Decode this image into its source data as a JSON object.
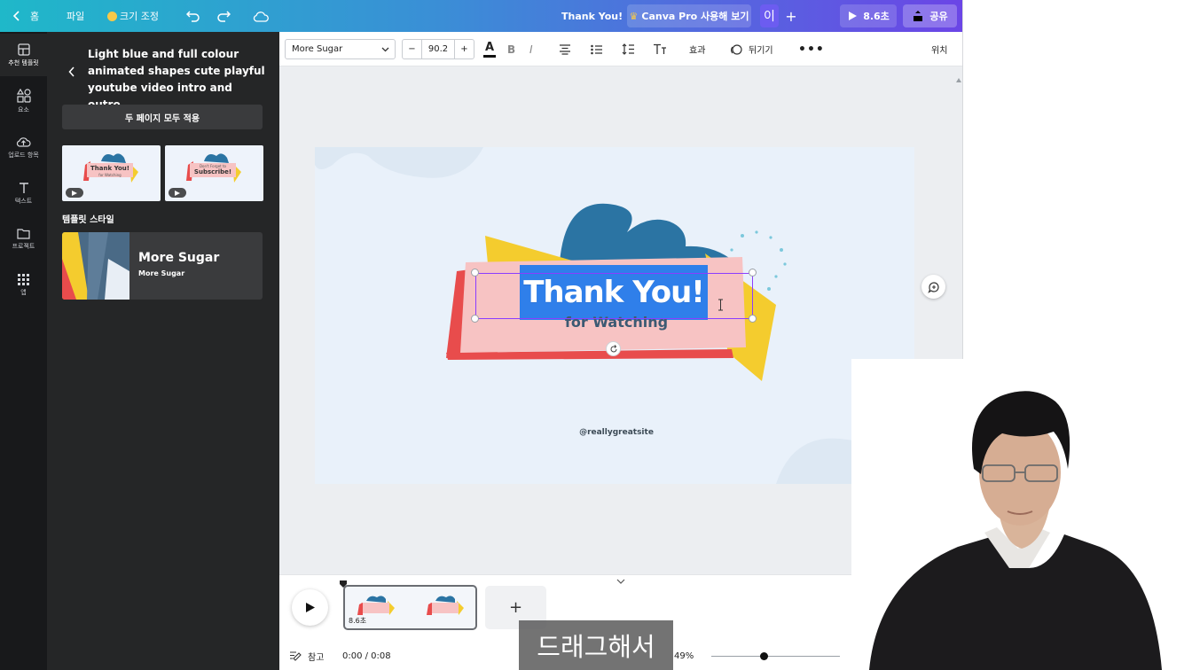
{
  "topbar": {
    "home_label": "홈",
    "file_label": "파일",
    "resize_label": "크기 조정",
    "doc_title": "Thank You!",
    "pro_label": "Canva Pro 사용해 보기",
    "avatar_initial": "이",
    "play_duration": "8.6초",
    "share_label": "공유"
  },
  "rail": {
    "items": [
      {
        "label": "추천 템플릿",
        "icon": "template-icon"
      },
      {
        "label": "요소",
        "icon": "elements-icon"
      },
      {
        "label": "업로드 항목",
        "icon": "upload-cloud-icon"
      },
      {
        "label": "텍스트",
        "icon": "text-icon"
      },
      {
        "label": "프로젝트",
        "icon": "folder-icon"
      },
      {
        "label": "앱",
        "icon": "apps-grid-icon"
      }
    ]
  },
  "panel": {
    "title": "Light blue and full colour animated shapes cute playful youtube video intro and outro",
    "apply_label": "두 페이지 모두 적용",
    "section_label": "템플릿 스타일",
    "style_name": "More Sugar",
    "style_sub": "More Sugar",
    "thumb1_title": "Thank You!",
    "thumb1_sub": "for Watching",
    "thumb2_title": "Subscribe!",
    "thumb2_sub": "Don't Forget to"
  },
  "format": {
    "font": "More Sugar",
    "size_minus": "−",
    "font_size": "90.2",
    "size_plus": "+",
    "bold_label": "B",
    "italic_label": "I",
    "effects_label": "효과",
    "animate_label": "뒤기기",
    "position_label": "위치"
  },
  "design": {
    "title": "Thank You!",
    "subtitle": "for Watching",
    "site": "@reallygreatsite",
    "colors": {
      "blue": "#2f7fea",
      "pink": "#f7c3c3",
      "red": "#e84c4c",
      "yellow": "#f4cc2e",
      "navy": "#2b74a3"
    }
  },
  "timeline": {
    "clip_duration": "8.6초",
    "add_label": "+",
    "notes_label": "참고",
    "time": "0:00 / 0:08",
    "zoom": "49%",
    "zoom_fraction": 0.38
  },
  "caption": {
    "text": "드래그해서"
  }
}
